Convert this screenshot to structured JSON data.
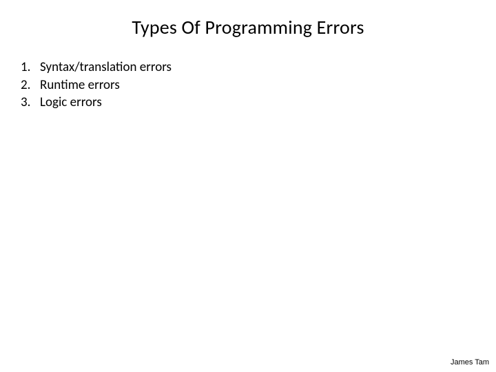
{
  "slide": {
    "title": "Types Of Programming Errors",
    "items": [
      {
        "number": "1.",
        "text": "Syntax/translation errors"
      },
      {
        "number": "2.",
        "text": "Runtime errors"
      },
      {
        "number": "3.",
        "text": "Logic errors"
      }
    ],
    "author": "James Tam"
  }
}
